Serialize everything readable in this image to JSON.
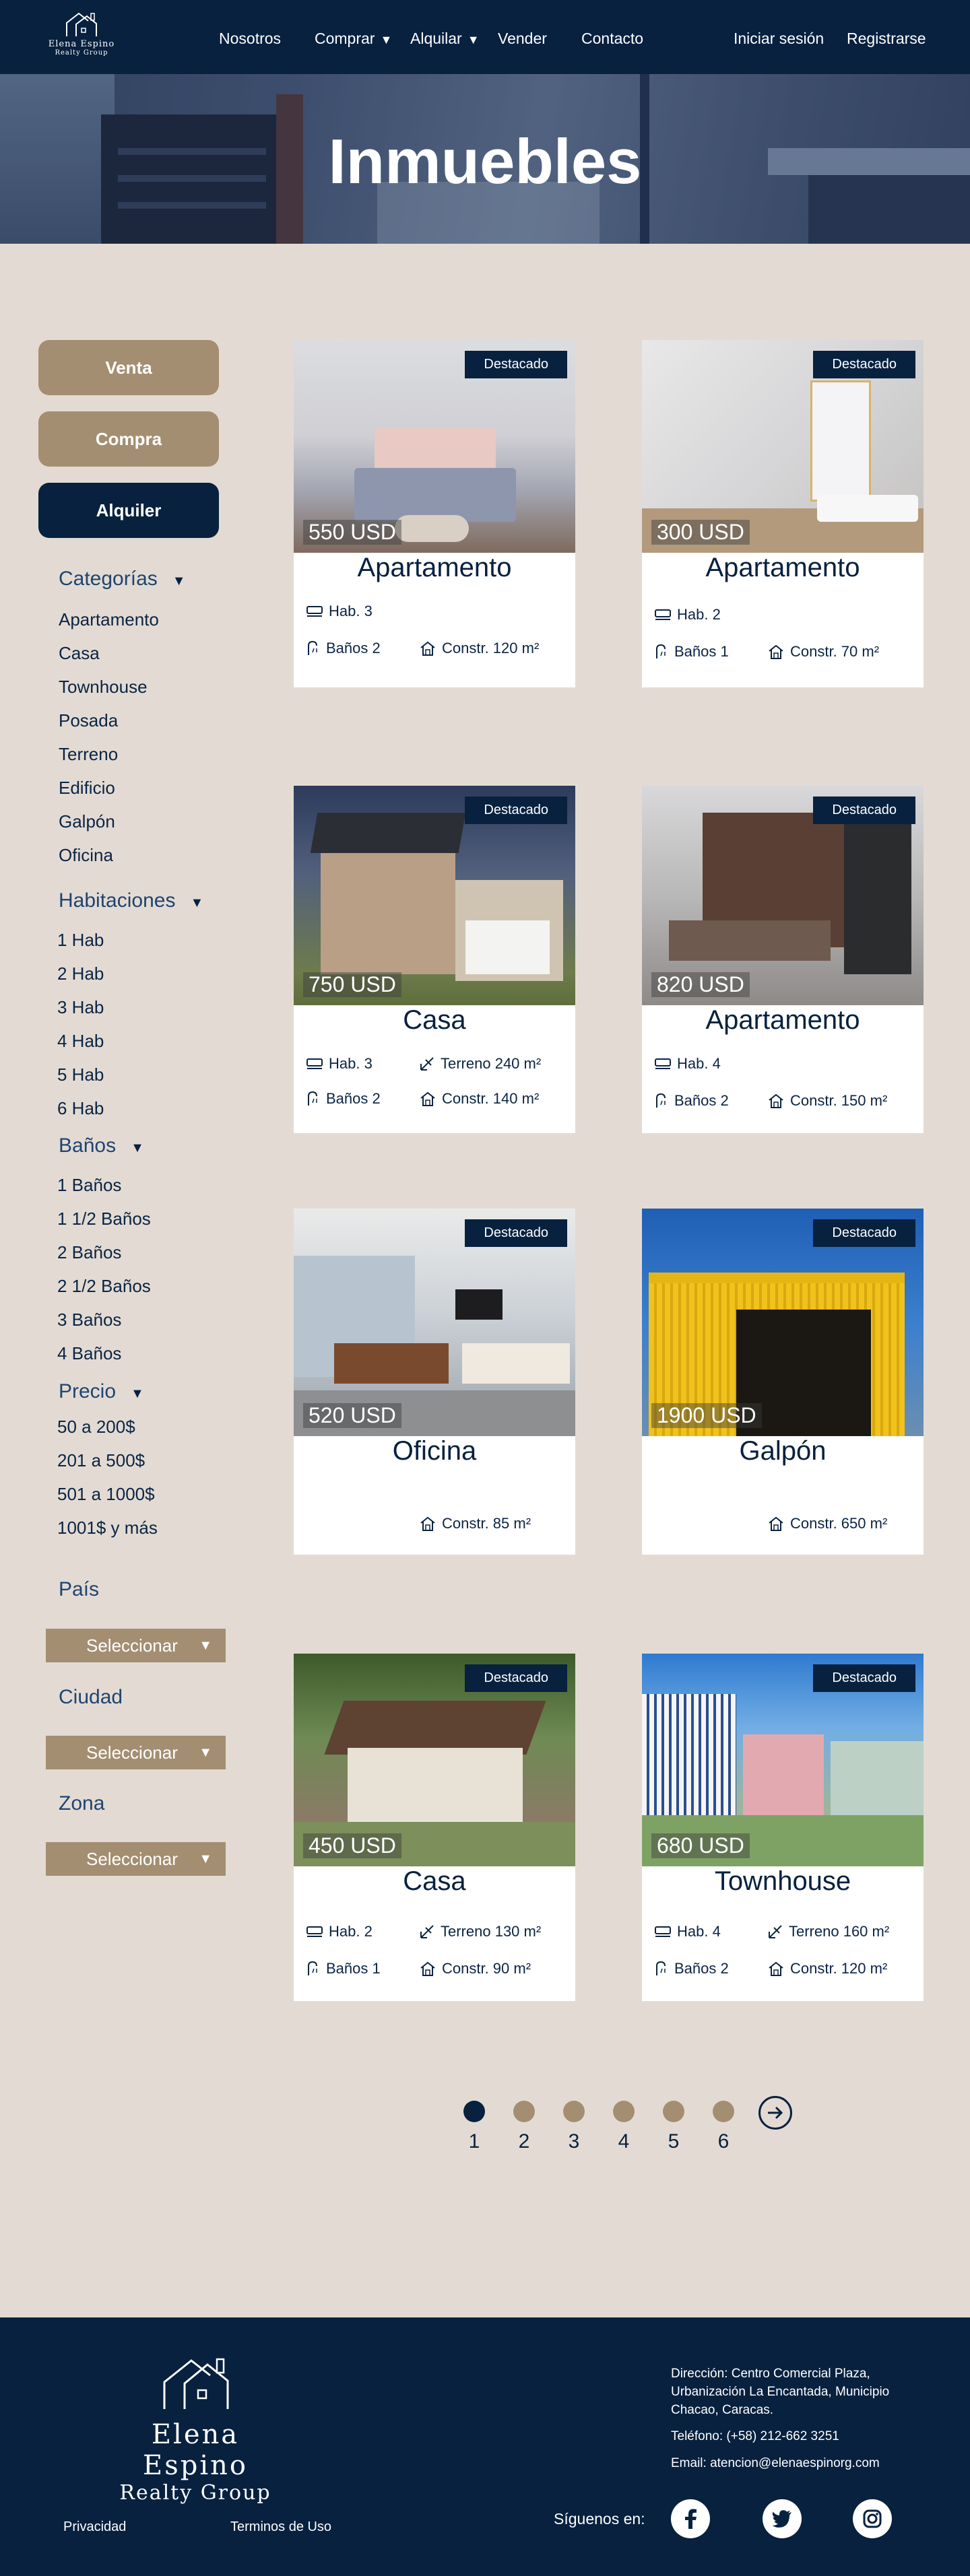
{
  "brand": {
    "name": "Elena Espino",
    "tagline": "Realty Group"
  },
  "nav": {
    "links": [
      "Nosotros",
      "Comprar",
      "Alquilar",
      "Vender",
      "Contacto"
    ],
    "login": "Iniciar sesión",
    "register": "Registrarse"
  },
  "hero": {
    "title": "Inmuebles"
  },
  "sidebar": {
    "types": [
      "Venta",
      "Compra",
      "Alquiler"
    ],
    "active_type": "Alquiler",
    "categories": {
      "label": "Categorías",
      "items": [
        "Apartamento",
        "Casa",
        "Townhouse",
        "Posada",
        "Terreno",
        "Edificio",
        "Galpón",
        "Oficina"
      ]
    },
    "rooms": {
      "label": "Habitaciones",
      "items": [
        "1 Hab",
        "2  Hab",
        "3 Hab",
        "4 Hab",
        "5  Hab",
        "6 Hab"
      ]
    },
    "baths": {
      "label": "Baños",
      "items": [
        "1 Baños",
        "1 1/2 Baños",
        "2 Baños",
        "2 1/2 Baños",
        "3  Baños",
        "4 Baños"
      ]
    },
    "price": {
      "label": "Precio",
      "items": [
        "50 a 200$",
        "201 a 500$",
        "501 a 1000$",
        "1001$ y más"
      ]
    },
    "country": {
      "label": "País",
      "value": "Seleccionar"
    },
    "city": {
      "label": "Ciudad",
      "value": "Seleccionar"
    },
    "zone": {
      "label": "Zona",
      "value": "Seleccionar"
    }
  },
  "badge_label": "Destacado",
  "listings": [
    {
      "price": "550 USD",
      "type": "Apartamento",
      "rooms": "Hab. 3",
      "baths": "Baños 2",
      "built": "Constr. 120 m²"
    },
    {
      "price": "300 USD",
      "type": "Apartamento",
      "rooms": "Hab. 2",
      "baths": "Baños 1",
      "built": "Constr. 70 m²"
    },
    {
      "price": "750 USD",
      "type": "Casa",
      "rooms": "Hab. 3",
      "land": "Terreno 240 m²",
      "baths": "Baños 2",
      "built": "Constr. 140 m²"
    },
    {
      "price": "820 USD",
      "type": "Apartamento",
      "rooms": "Hab. 4",
      "baths": "Baños 2",
      "built": "Constr. 150 m²"
    },
    {
      "price": "520 USD",
      "type": "Oficina",
      "built": "Constr. 85 m²"
    },
    {
      "price": "1900 USD",
      "type": "Galpón",
      "built": "Constr. 650 m²"
    },
    {
      "price": "450 USD",
      "type": "Casa",
      "rooms": "Hab. 2",
      "land": "Terreno 130 m²",
      "baths": "Baños 1",
      "built": "Constr. 90 m²"
    },
    {
      "price": "680 USD",
      "type": "Townhouse",
      "rooms": "Hab. 4",
      "land": "Terreno 160 m²",
      "baths": "Baños 2",
      "built": "Constr. 120 m²"
    }
  ],
  "pagination": {
    "pages": [
      "1",
      "2",
      "3",
      "4",
      "5",
      "6"
    ],
    "current": "1"
  },
  "footer": {
    "address": "Dirección: Centro Comercial Plaza, Urbanización La Encantada, Municipio Chacao, Caracas.",
    "phone": "Teléfono: (+58) 212-662 3251",
    "email": "Email: atencion@elenaespinorg.com",
    "privacy": "Privacidad",
    "terms": "Terminos de Uso",
    "follow": "Síguenos en:"
  },
  "colors": {
    "navy": "#07213f",
    "tan": "#a48e71",
    "page_bg": "#e3dbd3"
  }
}
